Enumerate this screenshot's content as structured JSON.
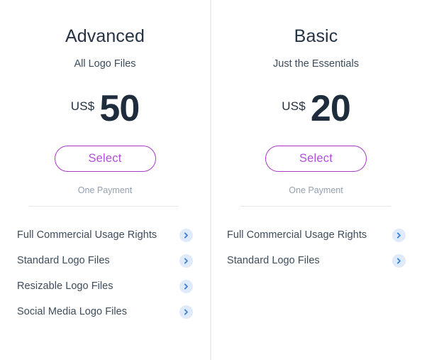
{
  "plans": [
    {
      "name": "Advanced",
      "subtitle": "All Logo Files",
      "currency": "US$",
      "amount": "50",
      "select_label": "Select",
      "payment_note": "One Payment",
      "features": [
        "Full Commercial Usage Rights",
        "Standard Logo Files",
        "Resizable Logo Files",
        "Social Media Logo Files"
      ]
    },
    {
      "name": "Basic",
      "subtitle": "Just the Essentials",
      "currency": "US$",
      "amount": "20",
      "select_label": "Select",
      "payment_note": "One Payment",
      "features": [
        "Full Commercial Usage Rights",
        "Standard Logo Files"
      ]
    }
  ],
  "icons": {
    "chevron": "chevron-right-icon"
  },
  "colors": {
    "heading": "#253344",
    "body_text": "#3e4c5b",
    "price": "#1e2c3b",
    "accent_purple": "#b14fd8",
    "button_border": "#ab38c9",
    "muted": "#93a1b0",
    "divider": "#e4e8ec",
    "separator": "#edf0f2",
    "chevron_circle": "#dfeafa",
    "chevron_glyph": "#3f86d4"
  }
}
